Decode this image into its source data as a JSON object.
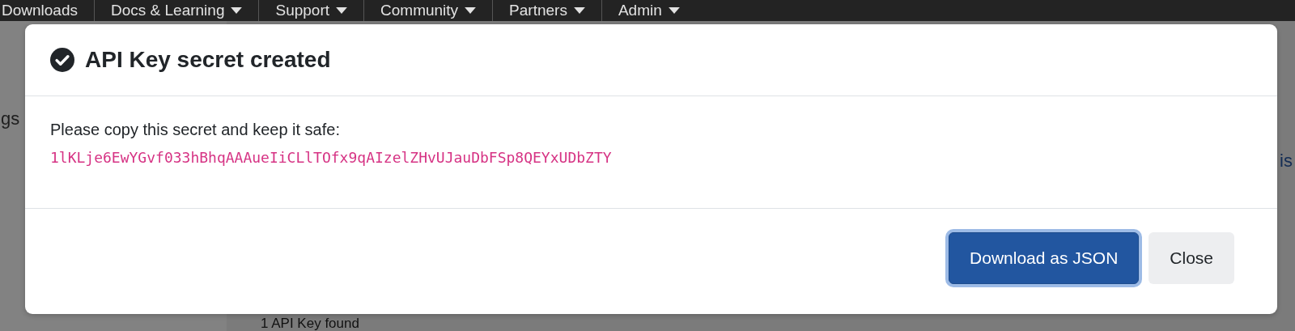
{
  "nav": {
    "items": [
      {
        "label": "Downloads",
        "dropdown": false
      },
      {
        "label": "Docs & Learning",
        "dropdown": true
      },
      {
        "label": "Support",
        "dropdown": true
      },
      {
        "label": "Community",
        "dropdown": true
      },
      {
        "label": "Partners",
        "dropdown": true
      },
      {
        "label": "Admin",
        "dropdown": true
      }
    ]
  },
  "background": {
    "sidebar_text": "gs",
    "side_text": "is",
    "count_text": "1 API Key found"
  },
  "modal": {
    "title": "API Key secret created",
    "message": "Please copy this secret and keep it safe:",
    "secret": "1lKLje6EwYGvf033hBhqAAAueIiCLlTOfx9qAIzelZHvUJauDbFSp8QEYxUDbZTY",
    "buttons": [
      {
        "label": "Download as JSON",
        "kind": "primary",
        "focused": true
      },
      {
        "label": "Close",
        "kind": "secondary",
        "focused": false
      }
    ]
  }
}
